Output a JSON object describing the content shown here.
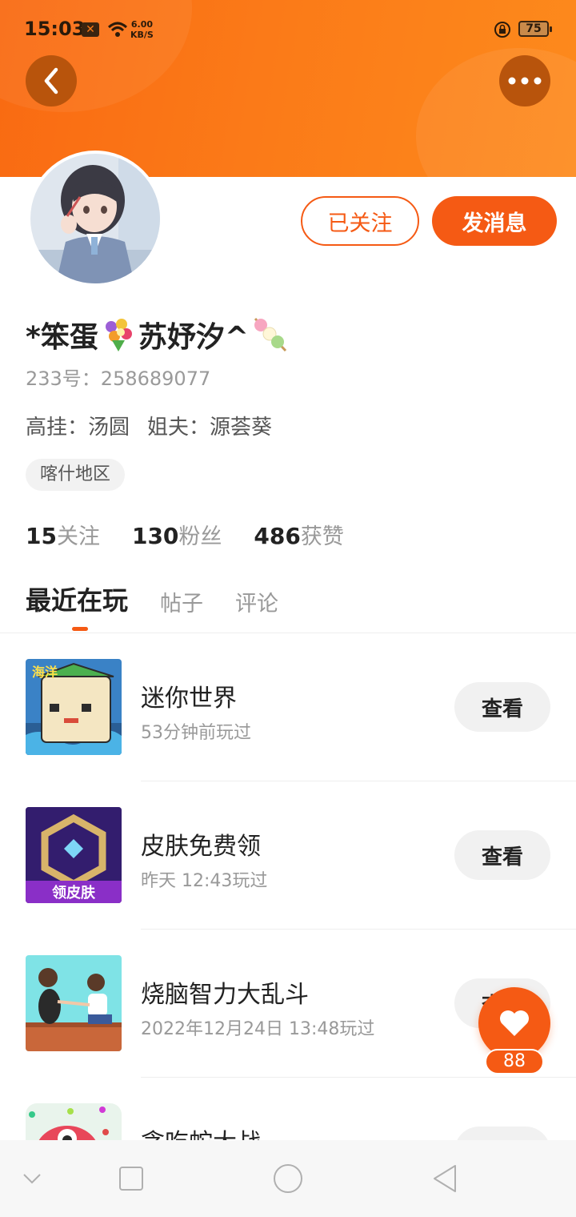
{
  "status_bar": {
    "time": "15:03",
    "notification_icon": "x-box-icon",
    "net_speed_value": "6.00",
    "net_speed_unit": "KB/S",
    "battery_level": "75"
  },
  "header": {
    "back_icon": "chevron-left-icon",
    "more_icon": "more-dots-icon",
    "accent_color": "#f55a14"
  },
  "profile": {
    "nickname_part1": "*笨蛋",
    "nickname_part2": "苏妤汐^",
    "user_id": "233号：258689077",
    "relation_1": "高挂：汤圆",
    "relation_2": "姐夫：源荟葵",
    "region": "喀什地区",
    "follow_label": "已关注",
    "message_label": "发消息"
  },
  "stats": {
    "following_count": "15",
    "following_label": "关注",
    "fans_count": "130",
    "fans_label": "粉丝",
    "likes_count": "486",
    "likes_label": "获赞"
  },
  "tabs": {
    "recent": "最近在玩",
    "posts": "帖子",
    "comments": "评论"
  },
  "games": [
    {
      "name": "迷你世界",
      "time": "53分钟前玩过",
      "action": "查看"
    },
    {
      "name": "皮肤免费领",
      "time": "昨天 12:43玩过",
      "action": "查看",
      "thumb_text": "领皮肤"
    },
    {
      "name": "烧脑智力大乱斗",
      "time": "2022年12月24日 13:48玩过",
      "action": "查看"
    },
    {
      "name": "贪吃蛇大战",
      "time": "",
      "action": "查看"
    }
  ],
  "like_badge": {
    "count": "88"
  },
  "nav_bar": {
    "items": [
      "chevron-down-icon",
      "square-icon",
      "circle-icon",
      "triangle-back-icon"
    ]
  }
}
